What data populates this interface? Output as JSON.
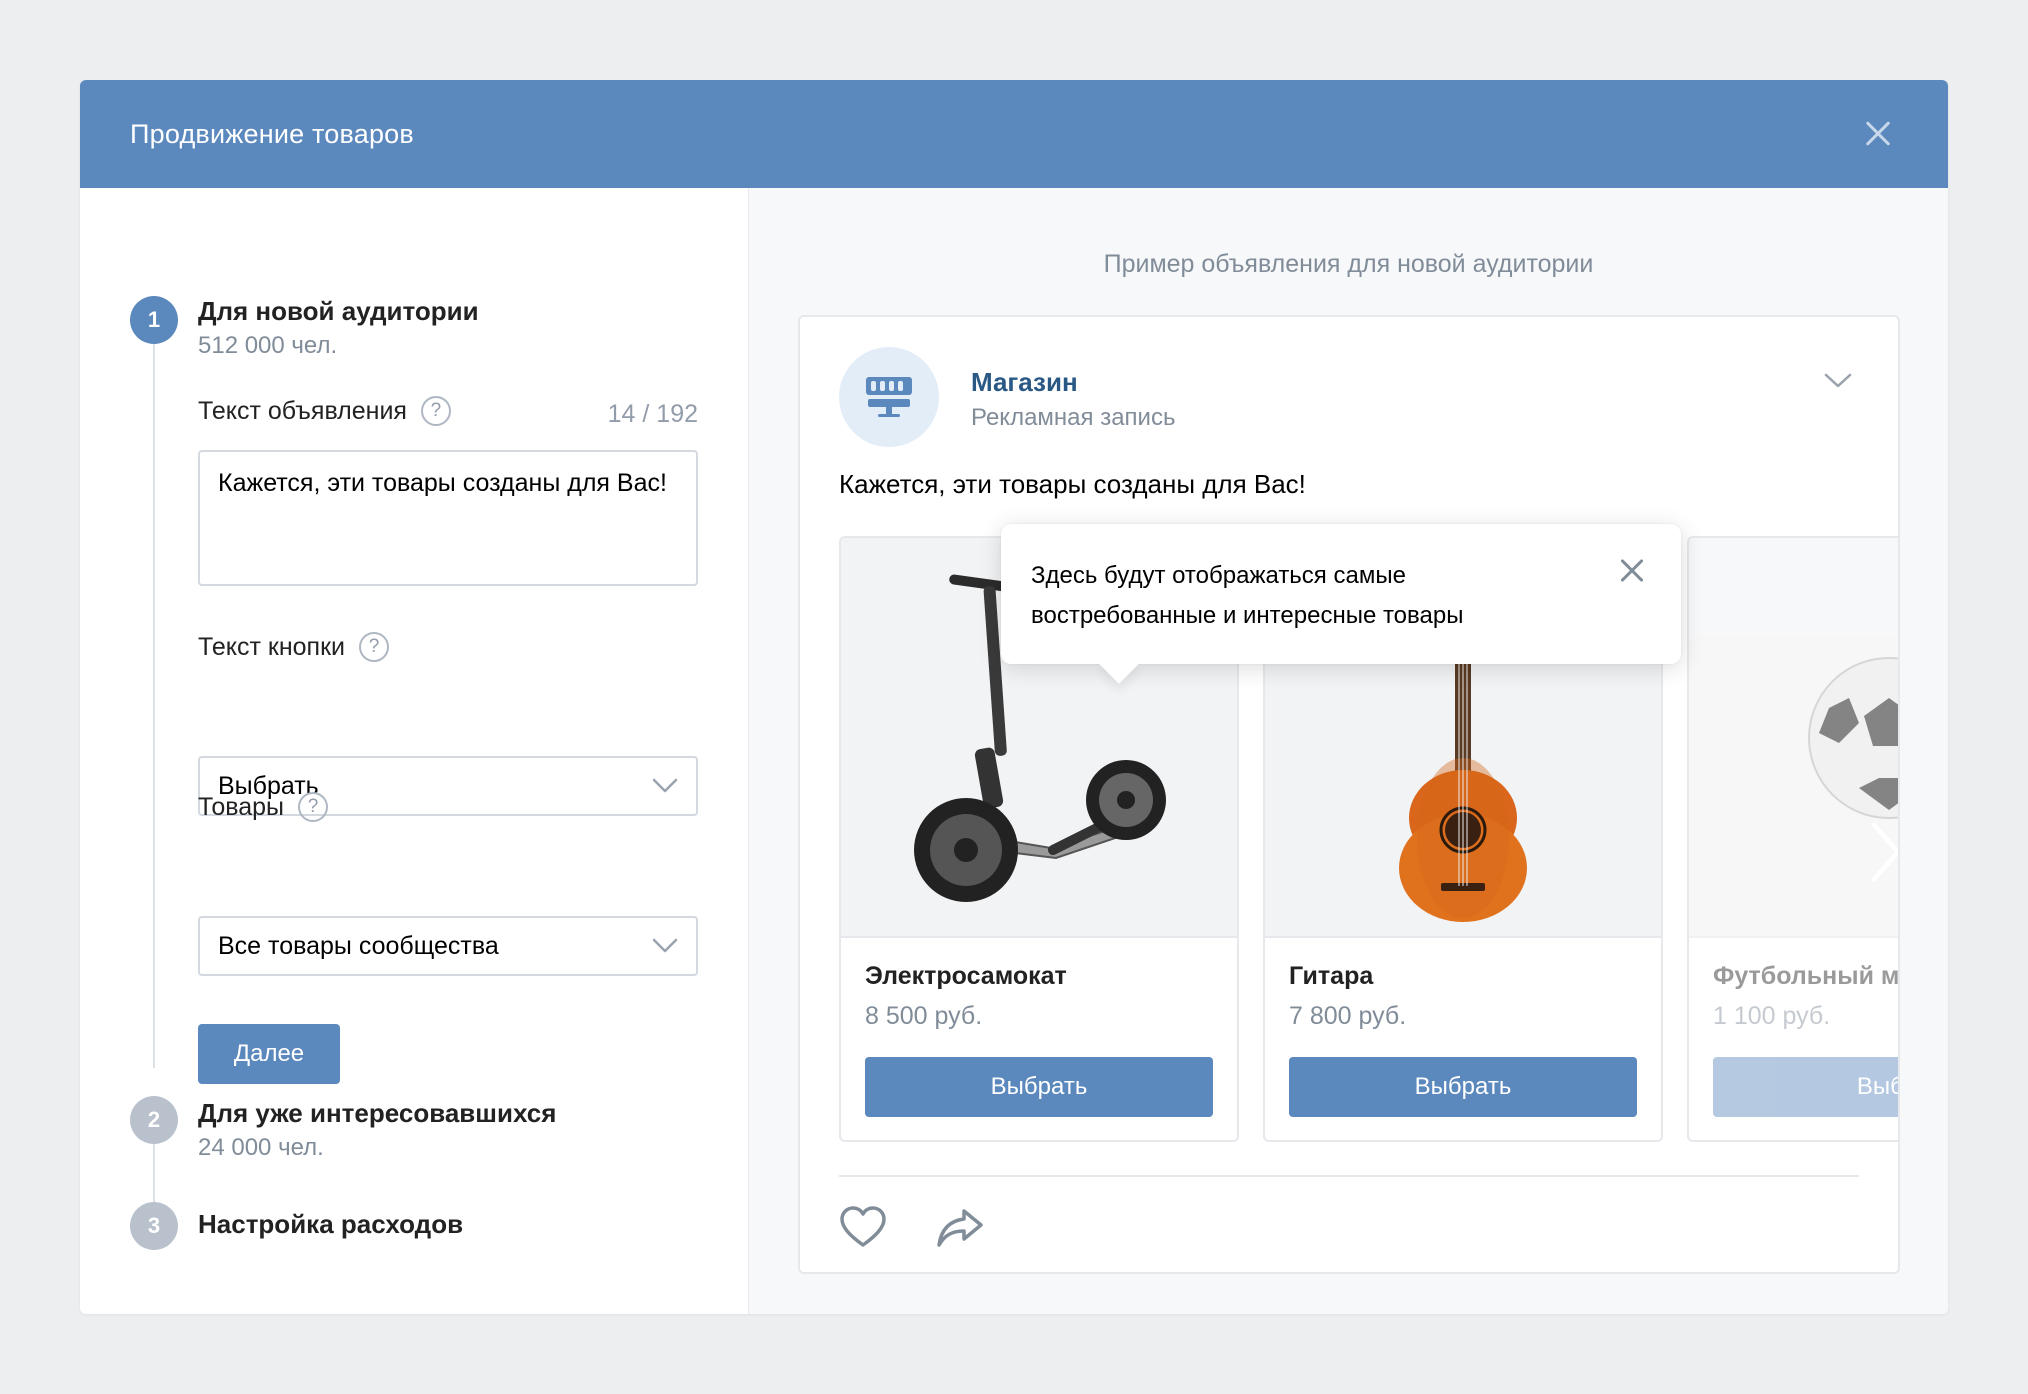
{
  "modal": {
    "title": "Продвижение товаров"
  },
  "steps": [
    {
      "number": "1",
      "title": "Для новой аудитории",
      "subtitle": "512 000 чел.",
      "state": "active"
    },
    {
      "number": "2",
      "title": "Для уже интересовавшихся",
      "subtitle": "24 000 чел.",
      "state": "inactive"
    },
    {
      "number": "3",
      "title": "Настройка расходов",
      "subtitle": "",
      "state": "inactive"
    }
  ],
  "form": {
    "ad_text_label": "Текст объявления",
    "ad_text_counter": "14 / 192",
    "ad_text_value": "Кажется, эти товары созданы для Вас!",
    "button_text_label": "Текст кнопки",
    "button_text_value": "Выбрать",
    "products_label": "Товары",
    "products_value": "Все товары сообщества",
    "next_label": "Далее",
    "help_glyph": "?"
  },
  "preview": {
    "caption": "Пример объявления для новой аудитории",
    "shop_name": "Магазин",
    "shop_sub": "Рекламная запись",
    "post_text": "Кажется, эти товары созданы для Вас!",
    "tooltip_line1": "Здесь будут отображаться самые",
    "tooltip_line2": "востребованные и интересные товары",
    "products": [
      {
        "name": "Электросамокат",
        "price": "8 500 руб.",
        "button": "Выбрать"
      },
      {
        "name": "Гитара",
        "price": "7 800 руб.",
        "button": "Выбрать"
      },
      {
        "name": "Футбольный м",
        "price": "1 100 руб.",
        "button": "Выбр"
      }
    ]
  },
  "colors": {
    "accent": "#5b88bd",
    "link": "#2a5885",
    "muted": "#818c99"
  },
  "icons": {
    "close": "close-icon",
    "help": "help-icon",
    "chevron": "chevron-down-icon",
    "avatar": "shop-icon",
    "like": "heart-icon",
    "share": "share-icon",
    "next": "chevron-right-icon"
  }
}
